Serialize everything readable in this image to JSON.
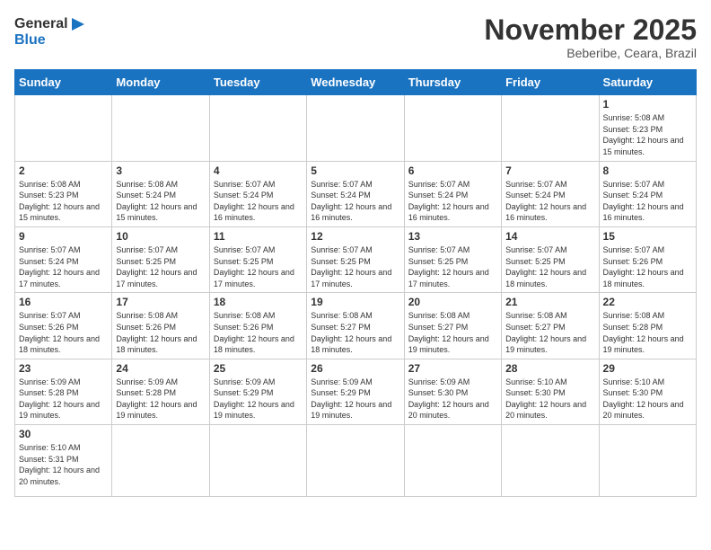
{
  "logo": {
    "text_general": "General",
    "text_blue": "Blue"
  },
  "title": "November 2025",
  "subtitle": "Beberibe, Ceara, Brazil",
  "days_of_week": [
    "Sunday",
    "Monday",
    "Tuesday",
    "Wednesday",
    "Thursday",
    "Friday",
    "Saturday"
  ],
  "weeks": [
    [
      {
        "day": "",
        "info": ""
      },
      {
        "day": "",
        "info": ""
      },
      {
        "day": "",
        "info": ""
      },
      {
        "day": "",
        "info": ""
      },
      {
        "day": "",
        "info": ""
      },
      {
        "day": "",
        "info": ""
      },
      {
        "day": "1",
        "info": "Sunrise: 5:08 AM\nSunset: 5:23 PM\nDaylight: 12 hours and 15 minutes."
      }
    ],
    [
      {
        "day": "2",
        "info": "Sunrise: 5:08 AM\nSunset: 5:23 PM\nDaylight: 12 hours and 15 minutes."
      },
      {
        "day": "3",
        "info": "Sunrise: 5:08 AM\nSunset: 5:24 PM\nDaylight: 12 hours and 15 minutes."
      },
      {
        "day": "4",
        "info": "Sunrise: 5:07 AM\nSunset: 5:24 PM\nDaylight: 12 hours and 16 minutes."
      },
      {
        "day": "5",
        "info": "Sunrise: 5:07 AM\nSunset: 5:24 PM\nDaylight: 12 hours and 16 minutes."
      },
      {
        "day": "6",
        "info": "Sunrise: 5:07 AM\nSunset: 5:24 PM\nDaylight: 12 hours and 16 minutes."
      },
      {
        "day": "7",
        "info": "Sunrise: 5:07 AM\nSunset: 5:24 PM\nDaylight: 12 hours and 16 minutes."
      },
      {
        "day": "8",
        "info": "Sunrise: 5:07 AM\nSunset: 5:24 PM\nDaylight: 12 hours and 16 minutes."
      }
    ],
    [
      {
        "day": "9",
        "info": "Sunrise: 5:07 AM\nSunset: 5:24 PM\nDaylight: 12 hours and 17 minutes."
      },
      {
        "day": "10",
        "info": "Sunrise: 5:07 AM\nSunset: 5:25 PM\nDaylight: 12 hours and 17 minutes."
      },
      {
        "day": "11",
        "info": "Sunrise: 5:07 AM\nSunset: 5:25 PM\nDaylight: 12 hours and 17 minutes."
      },
      {
        "day": "12",
        "info": "Sunrise: 5:07 AM\nSunset: 5:25 PM\nDaylight: 12 hours and 17 minutes."
      },
      {
        "day": "13",
        "info": "Sunrise: 5:07 AM\nSunset: 5:25 PM\nDaylight: 12 hours and 17 minutes."
      },
      {
        "day": "14",
        "info": "Sunrise: 5:07 AM\nSunset: 5:25 PM\nDaylight: 12 hours and 18 minutes."
      },
      {
        "day": "15",
        "info": "Sunrise: 5:07 AM\nSunset: 5:26 PM\nDaylight: 12 hours and 18 minutes."
      }
    ],
    [
      {
        "day": "16",
        "info": "Sunrise: 5:07 AM\nSunset: 5:26 PM\nDaylight: 12 hours and 18 minutes."
      },
      {
        "day": "17",
        "info": "Sunrise: 5:08 AM\nSunset: 5:26 PM\nDaylight: 12 hours and 18 minutes."
      },
      {
        "day": "18",
        "info": "Sunrise: 5:08 AM\nSunset: 5:26 PM\nDaylight: 12 hours and 18 minutes."
      },
      {
        "day": "19",
        "info": "Sunrise: 5:08 AM\nSunset: 5:27 PM\nDaylight: 12 hours and 18 minutes."
      },
      {
        "day": "20",
        "info": "Sunrise: 5:08 AM\nSunset: 5:27 PM\nDaylight: 12 hours and 19 minutes."
      },
      {
        "day": "21",
        "info": "Sunrise: 5:08 AM\nSunset: 5:27 PM\nDaylight: 12 hours and 19 minutes."
      },
      {
        "day": "22",
        "info": "Sunrise: 5:08 AM\nSunset: 5:28 PM\nDaylight: 12 hours and 19 minutes."
      }
    ],
    [
      {
        "day": "23",
        "info": "Sunrise: 5:09 AM\nSunset: 5:28 PM\nDaylight: 12 hours and 19 minutes."
      },
      {
        "day": "24",
        "info": "Sunrise: 5:09 AM\nSunset: 5:28 PM\nDaylight: 12 hours and 19 minutes."
      },
      {
        "day": "25",
        "info": "Sunrise: 5:09 AM\nSunset: 5:29 PM\nDaylight: 12 hours and 19 minutes."
      },
      {
        "day": "26",
        "info": "Sunrise: 5:09 AM\nSunset: 5:29 PM\nDaylight: 12 hours and 19 minutes."
      },
      {
        "day": "27",
        "info": "Sunrise: 5:09 AM\nSunset: 5:30 PM\nDaylight: 12 hours and 20 minutes."
      },
      {
        "day": "28",
        "info": "Sunrise: 5:10 AM\nSunset: 5:30 PM\nDaylight: 12 hours and 20 minutes."
      },
      {
        "day": "29",
        "info": "Sunrise: 5:10 AM\nSunset: 5:30 PM\nDaylight: 12 hours and 20 minutes."
      }
    ],
    [
      {
        "day": "30",
        "info": "Sunrise: 5:10 AM\nSunset: 5:31 PM\nDaylight: 12 hours and 20 minutes."
      },
      {
        "day": "",
        "info": ""
      },
      {
        "day": "",
        "info": ""
      },
      {
        "day": "",
        "info": ""
      },
      {
        "day": "",
        "info": ""
      },
      {
        "day": "",
        "info": ""
      },
      {
        "day": "",
        "info": ""
      }
    ]
  ]
}
